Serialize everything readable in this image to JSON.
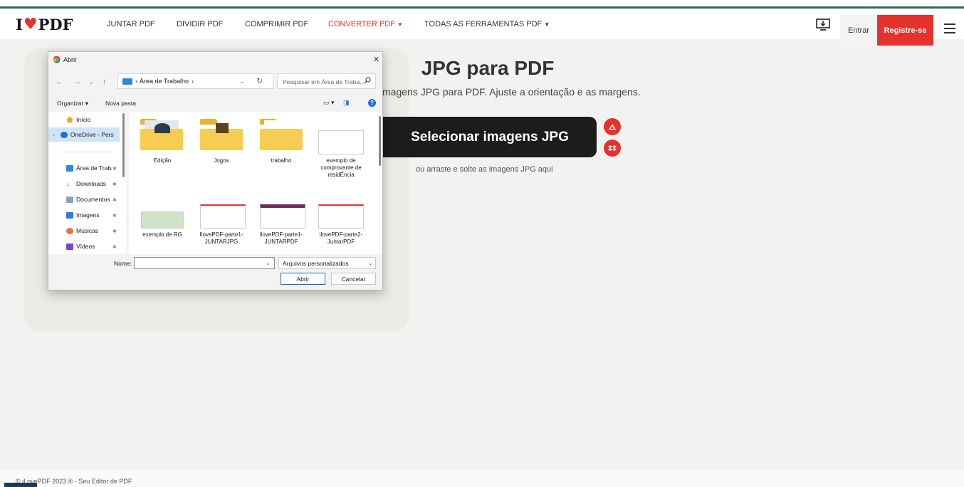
{
  "header": {
    "logo_left": "I",
    "logo_right": "PDF",
    "nav": [
      "JUNTAR PDF",
      "DIVIDIR PDF",
      "COMPRIMIR PDF",
      "CONVERTER PDF",
      "TODAS AS FERRAMENTAS PDF"
    ],
    "login": "Entrar",
    "signup": "Registre-se",
    "accent": "#e5322d",
    "brand_green": "#2f6e5e"
  },
  "main": {
    "title": "JPG para PDF",
    "subtitle": "magens JPG para PDF. Ajuste a orientação e as margens.",
    "select_button": "Selecionar imagens JPG",
    "drop_hint": "ou arraste e solte as imagens JPG aqui"
  },
  "footer": {
    "text": "© iLovePDF 2023 ® - Seu Editor de PDF"
  },
  "dialog": {
    "title": "Abrir",
    "address": "Área de Trabalho",
    "search_placeholder": "Pesquisar em Área de Traba...",
    "toolbar": {
      "organize": "Organizar",
      "new_folder": "Nova pasta"
    },
    "sidebar": [
      {
        "label": "Início",
        "pinned": false
      },
      {
        "label": "OneDrive - Pers",
        "pinned": false
      },
      {
        "label": "Área de Trabalho",
        "pinned": true
      },
      {
        "label": "Downloads",
        "pinned": true
      },
      {
        "label": "Documentos",
        "pinned": true
      },
      {
        "label": "Imagens",
        "pinned": true
      },
      {
        "label": "Músicas",
        "pinned": true
      },
      {
        "label": "Vídeos",
        "pinned": true
      }
    ],
    "files": [
      {
        "name": "Edição",
        "kind": "folder"
      },
      {
        "name": "Jogos",
        "kind": "folder"
      },
      {
        "name": "trabalho",
        "kind": "folder"
      },
      {
        "name": "exemplo de comprovante de residÊncia",
        "kind": "image"
      },
      {
        "name": "exemplo de RG",
        "kind": "image"
      },
      {
        "name": "IlovePDF-parte1-JUNTARJPG",
        "kind": "image"
      },
      {
        "name": "ilovePDF-parte1-JUNTARPDF",
        "kind": "image"
      },
      {
        "name": "ilovePDF-parte2-JuntarPDF",
        "kind": "image"
      }
    ],
    "name_label": "Nome:",
    "name_value": "",
    "file_type": "Arquivos personalizados",
    "open_button": "Abrir",
    "cancel_button": "Cancelar"
  }
}
